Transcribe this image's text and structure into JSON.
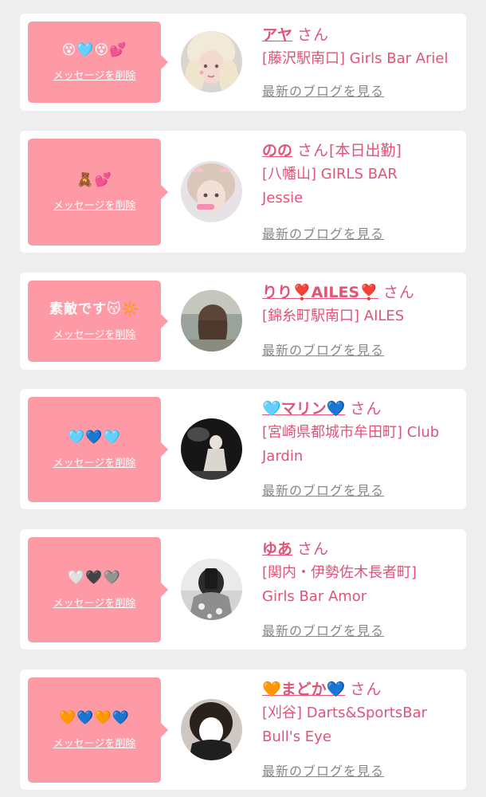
{
  "messages": [
    {
      "text": "😵🩵😵💕",
      "delete_label": "メッセージを削除",
      "name": "アヤ",
      "suffix": "さん",
      "suffix_extra": "",
      "shop": "[藤沢駅南口] Girls Bar Ariel",
      "blog_label": "最新のブログを見る"
    },
    {
      "text": "🧸💕",
      "delete_label": "メッセージを削除",
      "name": "のの",
      "suffix": "さん",
      "suffix_extra": "[本日出勤]",
      "shop": "[八幡山] GIRLS BAR Jessie",
      "blog_label": "最新のブログを見る"
    },
    {
      "text": "素敵です😽🔆",
      "delete_label": "メッセージを削除",
      "name": "りり❣️AILES❣️",
      "suffix": "さん",
      "suffix_extra": "",
      "shop": "[錦糸町駅南口] AILES",
      "blog_label": "最新のブログを見る"
    },
    {
      "text": "🩵💙🩵",
      "delete_label": "メッセージを削除",
      "name": "🩵マリン💙",
      "suffix": "さん",
      "suffix_extra": "",
      "shop": "[宮崎県都城市牟田町] Club Jardin",
      "blog_label": "最新のブログを見る"
    },
    {
      "text": "🤍🖤🩶",
      "delete_label": "メッセージを削除",
      "name": "ゆあ",
      "suffix": "さん",
      "suffix_extra": "",
      "shop": "[関内・伊勢佐木長者町] Girls Bar Amor",
      "blog_label": "最新のブログを見る"
    },
    {
      "text": "🧡💙🧡💙",
      "delete_label": "メッセージを削除",
      "name": "🧡まどか💙",
      "suffix": "さん",
      "suffix_extra": "",
      "shop": "[刈谷] Darts&SportsBar Bull's Eye",
      "blog_label": "最新のブログを見る"
    }
  ],
  "colors": {
    "page_background": "#eeeeee",
    "card_background": "#ffffff",
    "bubble_background": "#fe9aa6",
    "accent_text": "#e25377",
    "muted_link": "#888888"
  }
}
